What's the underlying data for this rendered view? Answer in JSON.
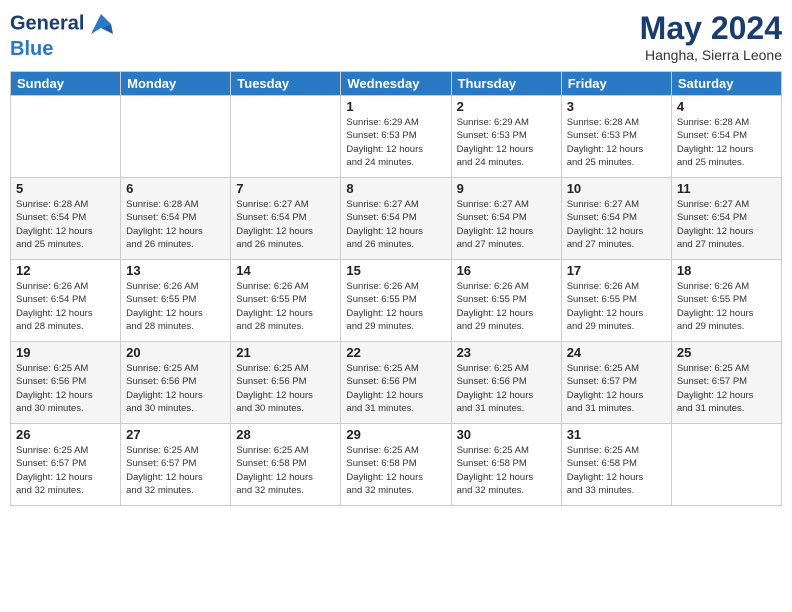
{
  "header": {
    "logo_line1": "General",
    "logo_line2": "Blue",
    "month_year": "May 2024",
    "location": "Hangha, Sierra Leone"
  },
  "weekdays": [
    "Sunday",
    "Monday",
    "Tuesday",
    "Wednesday",
    "Thursday",
    "Friday",
    "Saturday"
  ],
  "weeks": [
    [
      {
        "day": "",
        "info": ""
      },
      {
        "day": "",
        "info": ""
      },
      {
        "day": "",
        "info": ""
      },
      {
        "day": "1",
        "info": "Sunrise: 6:29 AM\nSunset: 6:53 PM\nDaylight: 12 hours\nand 24 minutes."
      },
      {
        "day": "2",
        "info": "Sunrise: 6:29 AM\nSunset: 6:53 PM\nDaylight: 12 hours\nand 24 minutes."
      },
      {
        "day": "3",
        "info": "Sunrise: 6:28 AM\nSunset: 6:53 PM\nDaylight: 12 hours\nand 25 minutes."
      },
      {
        "day": "4",
        "info": "Sunrise: 6:28 AM\nSunset: 6:54 PM\nDaylight: 12 hours\nand 25 minutes."
      }
    ],
    [
      {
        "day": "5",
        "info": "Sunrise: 6:28 AM\nSunset: 6:54 PM\nDaylight: 12 hours\nand 25 minutes."
      },
      {
        "day": "6",
        "info": "Sunrise: 6:28 AM\nSunset: 6:54 PM\nDaylight: 12 hours\nand 26 minutes."
      },
      {
        "day": "7",
        "info": "Sunrise: 6:27 AM\nSunset: 6:54 PM\nDaylight: 12 hours\nand 26 minutes."
      },
      {
        "day": "8",
        "info": "Sunrise: 6:27 AM\nSunset: 6:54 PM\nDaylight: 12 hours\nand 26 minutes."
      },
      {
        "day": "9",
        "info": "Sunrise: 6:27 AM\nSunset: 6:54 PM\nDaylight: 12 hours\nand 27 minutes."
      },
      {
        "day": "10",
        "info": "Sunrise: 6:27 AM\nSunset: 6:54 PM\nDaylight: 12 hours\nand 27 minutes."
      },
      {
        "day": "11",
        "info": "Sunrise: 6:27 AM\nSunset: 6:54 PM\nDaylight: 12 hours\nand 27 minutes."
      }
    ],
    [
      {
        "day": "12",
        "info": "Sunrise: 6:26 AM\nSunset: 6:54 PM\nDaylight: 12 hours\nand 28 minutes."
      },
      {
        "day": "13",
        "info": "Sunrise: 6:26 AM\nSunset: 6:55 PM\nDaylight: 12 hours\nand 28 minutes."
      },
      {
        "day": "14",
        "info": "Sunrise: 6:26 AM\nSunset: 6:55 PM\nDaylight: 12 hours\nand 28 minutes."
      },
      {
        "day": "15",
        "info": "Sunrise: 6:26 AM\nSunset: 6:55 PM\nDaylight: 12 hours\nand 29 minutes."
      },
      {
        "day": "16",
        "info": "Sunrise: 6:26 AM\nSunset: 6:55 PM\nDaylight: 12 hours\nand 29 minutes."
      },
      {
        "day": "17",
        "info": "Sunrise: 6:26 AM\nSunset: 6:55 PM\nDaylight: 12 hours\nand 29 minutes."
      },
      {
        "day": "18",
        "info": "Sunrise: 6:26 AM\nSunset: 6:55 PM\nDaylight: 12 hours\nand 29 minutes."
      }
    ],
    [
      {
        "day": "19",
        "info": "Sunrise: 6:25 AM\nSunset: 6:56 PM\nDaylight: 12 hours\nand 30 minutes."
      },
      {
        "day": "20",
        "info": "Sunrise: 6:25 AM\nSunset: 6:56 PM\nDaylight: 12 hours\nand 30 minutes."
      },
      {
        "day": "21",
        "info": "Sunrise: 6:25 AM\nSunset: 6:56 PM\nDaylight: 12 hours\nand 30 minutes."
      },
      {
        "day": "22",
        "info": "Sunrise: 6:25 AM\nSunset: 6:56 PM\nDaylight: 12 hours\nand 31 minutes."
      },
      {
        "day": "23",
        "info": "Sunrise: 6:25 AM\nSunset: 6:56 PM\nDaylight: 12 hours\nand 31 minutes."
      },
      {
        "day": "24",
        "info": "Sunrise: 6:25 AM\nSunset: 6:57 PM\nDaylight: 12 hours\nand 31 minutes."
      },
      {
        "day": "25",
        "info": "Sunrise: 6:25 AM\nSunset: 6:57 PM\nDaylight: 12 hours\nand 31 minutes."
      }
    ],
    [
      {
        "day": "26",
        "info": "Sunrise: 6:25 AM\nSunset: 6:57 PM\nDaylight: 12 hours\nand 32 minutes."
      },
      {
        "day": "27",
        "info": "Sunrise: 6:25 AM\nSunset: 6:57 PM\nDaylight: 12 hours\nand 32 minutes."
      },
      {
        "day": "28",
        "info": "Sunrise: 6:25 AM\nSunset: 6:58 PM\nDaylight: 12 hours\nand 32 minutes."
      },
      {
        "day": "29",
        "info": "Sunrise: 6:25 AM\nSunset: 6:58 PM\nDaylight: 12 hours\nand 32 minutes."
      },
      {
        "day": "30",
        "info": "Sunrise: 6:25 AM\nSunset: 6:58 PM\nDaylight: 12 hours\nand 32 minutes."
      },
      {
        "day": "31",
        "info": "Sunrise: 6:25 AM\nSunset: 6:58 PM\nDaylight: 12 hours\nand 33 minutes."
      },
      {
        "day": "",
        "info": ""
      }
    ]
  ]
}
